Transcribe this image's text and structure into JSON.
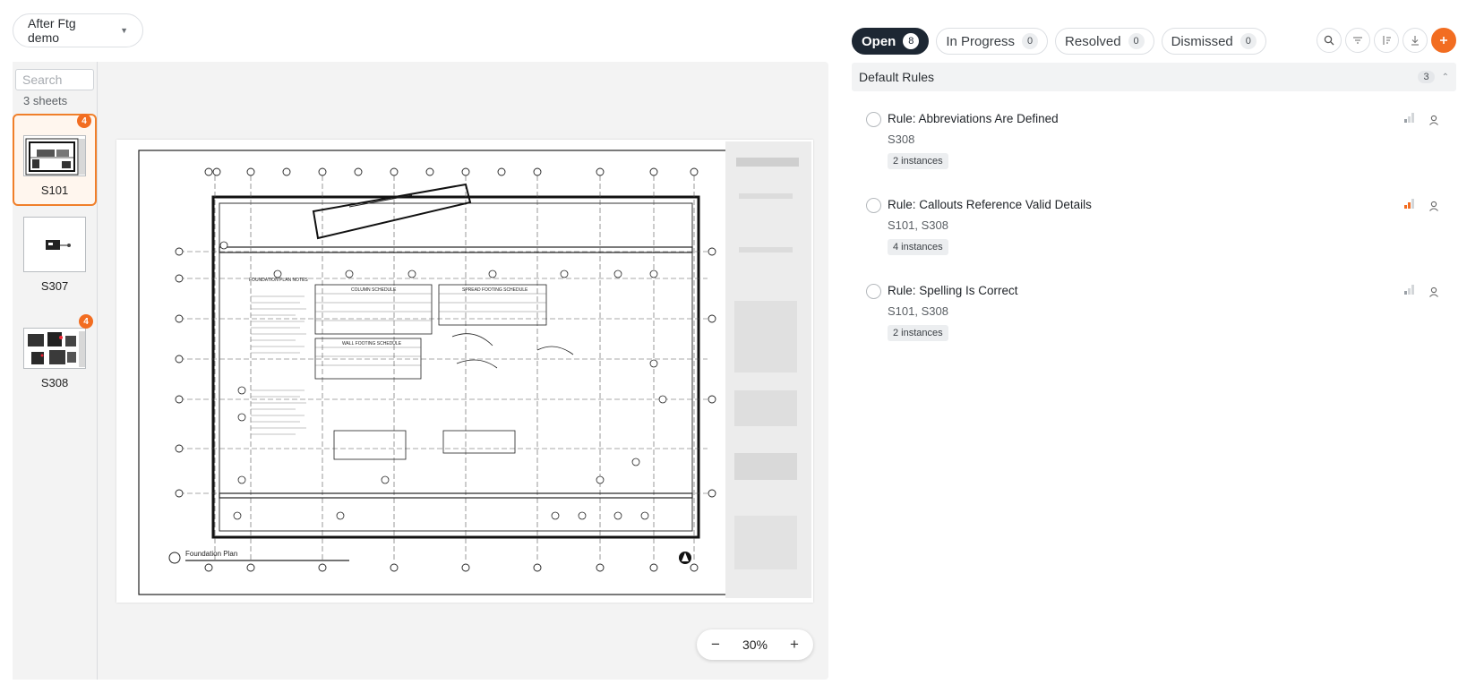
{
  "project": {
    "name": "After Ftg demo"
  },
  "sheets_panel": {
    "search_placeholder": "Search",
    "count_text": "3 sheets",
    "items": [
      {
        "label": "S101",
        "badge": "4",
        "selected": true
      },
      {
        "label": "S307",
        "badge": "",
        "selected": false
      },
      {
        "label": "S308",
        "badge": "4",
        "selected": false
      }
    ]
  },
  "drawing": {
    "title": "Foundation Plan",
    "notes_heading": "FOUNDATION PLAN NOTES",
    "column_schedule": "COLUMN SCHEDULE",
    "spread_footing_schedule": "SPREAD FOOTING SCHEDULE",
    "wall_footing_schedule": "WALL FOOTING SCHEDULE"
  },
  "zoom": {
    "minus": "−",
    "level": "30%",
    "plus": "+"
  },
  "status_tabs": [
    {
      "label": "Open",
      "count": "8",
      "active": true
    },
    {
      "label": "In Progress",
      "count": "0",
      "active": false
    },
    {
      "label": "Resolved",
      "count": "0",
      "active": false
    },
    {
      "label": "Dismissed",
      "count": "0",
      "active": false
    }
  ],
  "toolbar_icons": [
    "search-icon",
    "filter-icon",
    "sort-icon",
    "download-icon",
    "add-icon"
  ],
  "group": {
    "title": "Default Rules",
    "count": "3"
  },
  "rules": [
    {
      "title": "Rule: Abbreviations Are Defined",
      "sheets": "S308",
      "instances": "2 instances",
      "severity": "low"
    },
    {
      "title": "Rule: Callouts Reference Valid Details",
      "sheets": "S101, S308",
      "instances": "4 instances",
      "severity": "medium"
    },
    {
      "title": "Rule: Spelling Is Correct",
      "sheets": "S101, S308",
      "instances": "2 instances",
      "severity": "low"
    }
  ],
  "colors": {
    "accent": "#f26d21",
    "active_tab": "#1d2733",
    "severity_active": "#f26d21",
    "severity_inactive": "#c8cbcf"
  }
}
